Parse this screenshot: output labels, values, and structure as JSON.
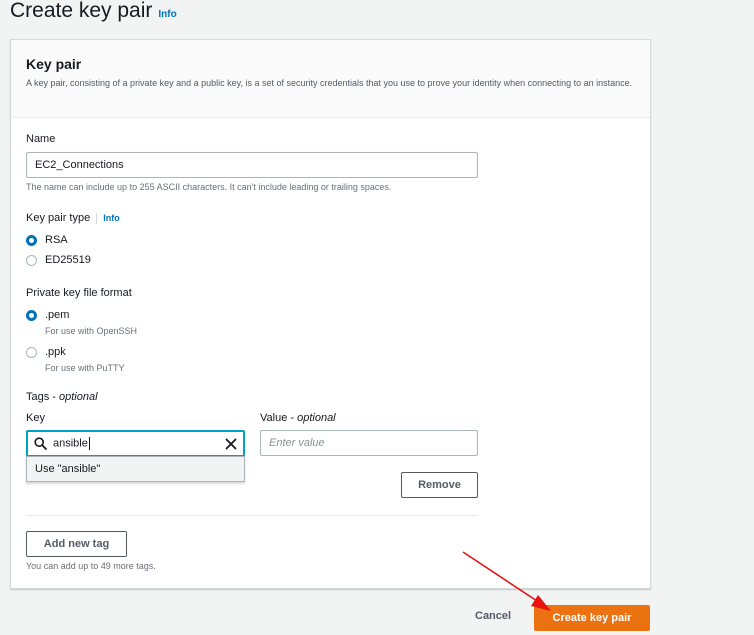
{
  "header": {
    "title": "Create key pair",
    "info": "Info"
  },
  "panel": {
    "title": "Key pair",
    "description": "A key pair, consisting of a private key and a public key, is a set of security credentials that you use to prove your identity when connecting to an instance."
  },
  "name_field": {
    "label": "Name",
    "value": "EC2_Connections",
    "hint": "The name can include up to 255 ASCII characters. It can't include leading or trailing spaces."
  },
  "key_type": {
    "label": "Key pair type",
    "info": "Info",
    "options": [
      {
        "label": "RSA",
        "checked": true
      },
      {
        "label": "ED25519",
        "checked": false
      }
    ]
  },
  "file_format": {
    "label": "Private key file format",
    "options": [
      {
        "label": ".pem",
        "sub": "For use with OpenSSH",
        "checked": true
      },
      {
        "label": ".ppk",
        "sub": "For use with PuTTY",
        "checked": false
      }
    ]
  },
  "tags": {
    "label_main": "Tags - ",
    "label_optional": "optional",
    "key_label": "Key",
    "key_value": "ansible",
    "dropdown_option": "Use \"ansible\"",
    "value_label_main": "Value - ",
    "value_label_optional": "optional",
    "value_placeholder": "Enter value",
    "remove_button": "Remove",
    "add_button": "Add new tag",
    "hint": "You can add up to 49 more tags."
  },
  "footer": {
    "cancel": "Cancel",
    "create": "Create key pair"
  },
  "colors": {
    "primary": "#ec7211",
    "link": "#0073bb",
    "focus": "#00a1c9",
    "annotation": "#e8110f"
  }
}
